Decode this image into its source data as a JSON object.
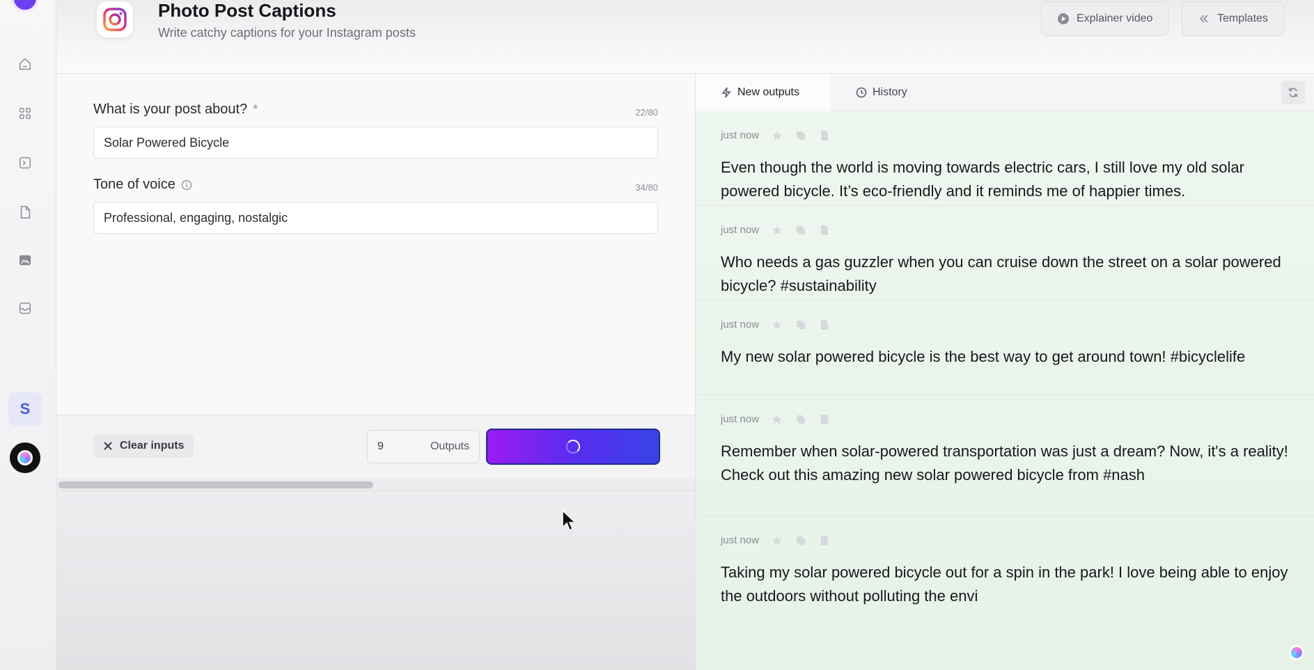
{
  "header": {
    "title": "Photo Post Captions",
    "subtitle": "Write catchy captions for your Instagram posts",
    "explainer_label": "Explainer video",
    "templates_label": "Templates"
  },
  "sidebar": {
    "avatar_letter": "S"
  },
  "form": {
    "topic": {
      "label": "What is your post about?",
      "required_mark": "*",
      "counter": "22/80",
      "value": "Solar Powered Bicycle"
    },
    "tone": {
      "label": "Tone of voice",
      "counter": "34/80",
      "value": "Professional, engaging, nostalgic"
    }
  },
  "actions": {
    "clear_label": "Clear inputs",
    "outputs_count": "9",
    "outputs_label": "Outputs"
  },
  "output_tabs": {
    "new_label": "New outputs",
    "history_label": "History"
  },
  "outputs": [
    {
      "time": "just now",
      "text": "Even though the world is moving towards electric cars, I still love my old solar powered bicycle. It’s eco-friendly and it reminds me of happier times."
    },
    {
      "time": "just now",
      "text": "Who needs a gas guzzler when you can cruise down the street on a solar powered bicycle? #sustainability"
    },
    {
      "time": "just now",
      "text": "My new solar powered bicycle is the best way to get around town! #bicyclelife"
    },
    {
      "time": "just now",
      "text": "Remember when solar-powered transportation was just a dream? Now, it's a reality! Check out this amazing new solar powered bicycle from #nash"
    },
    {
      "time": "just now",
      "text": "Taking my solar powered bicycle out for a spin in the park! I love being able to enjoy the outdoors without polluting the envi"
    }
  ],
  "colors": {
    "accent_start": "#9a1df0",
    "accent_end": "#3744e6",
    "output_bg": "#eef7f0"
  }
}
